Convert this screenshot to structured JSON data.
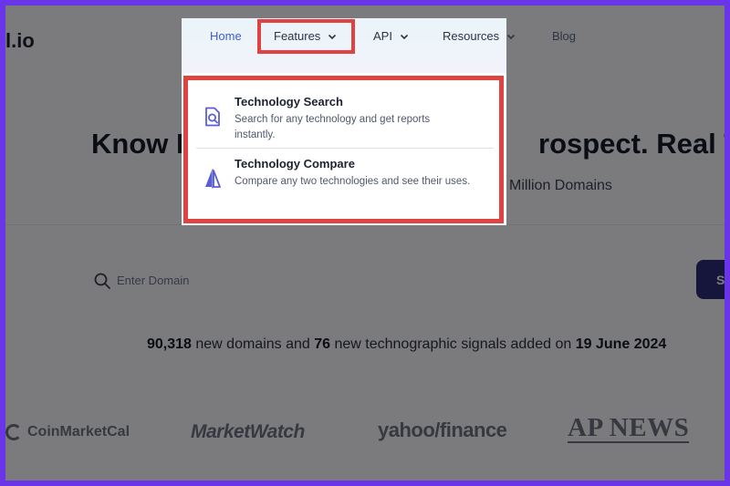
{
  "site": {
    "logo_text": "l.io"
  },
  "nav": {
    "items": [
      {
        "label": "Home",
        "has_dropdown": false,
        "active": true
      },
      {
        "label": "Features",
        "has_dropdown": true,
        "active": false
      },
      {
        "label": "API",
        "has_dropdown": true,
        "active": false
      },
      {
        "label": "Resources",
        "has_dropdown": true,
        "active": false
      },
      {
        "label": "Blog",
        "has_dropdown": false,
        "active": false
      }
    ]
  },
  "features_dropdown": {
    "items": [
      {
        "icon": "document-search-icon",
        "title": "Technology Search",
        "description": "Search for any technology and get reports instantly."
      },
      {
        "icon": "compare-icon",
        "title": "Technology Compare",
        "description": "Compare any two technologies and see their uses."
      }
    ]
  },
  "hero": {
    "title_left": "Know E",
    "title_right": "rospect. Real Time",
    "subtitle_fragment": "Million Domains"
  },
  "search": {
    "placeholder": "Enter Domain",
    "button_label": "Se"
  },
  "stats": {
    "domains_count": "90,318",
    "text_1": " new domains and ",
    "signals_count": "76",
    "text_2": " new technographic signals added on ",
    "date": "19 June 2024"
  },
  "brands": [
    "CoinMarketCal",
    "MarketWatch",
    "yahoo/finance",
    "AP NEWS"
  ],
  "colors": {
    "frame": "#6a35e8",
    "highlight": "#e04141",
    "nav_active": "#3b5bdb",
    "icon_accent": "#5b5fd6",
    "search_button": "#2c2a78"
  }
}
